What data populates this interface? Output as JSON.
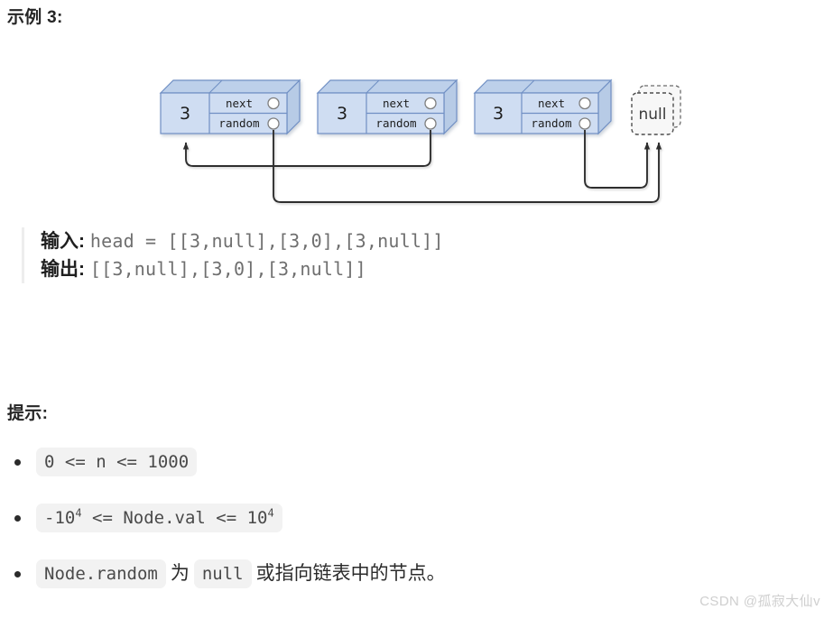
{
  "example": {
    "heading": "示例 3:",
    "input_label": "输入:",
    "input_value": "head = [[3,null],[3,0],[3,null]]",
    "output_label": "输出:",
    "output_value": "[[3,null],[3,0],[3,null]]"
  },
  "diagram": {
    "node_value": "3",
    "next_label": "next",
    "random_label": "random",
    "null_label": "null",
    "node_fill": "#cfddf2",
    "node_top_fill": "#bdd0ea",
    "node_side_fill": "#b7cbe6",
    "node_border": "#6f8fc4",
    "port_fill": "#ffffff",
    "port_border": "#7f7f7f",
    "arrow_color": "#2f2f2f",
    "null_border": "#6b6b6b",
    "null_fill": "#f7f7f7",
    "nodes": [
      {
        "value": "3",
        "next_label": "next",
        "random_label": "random",
        "next_target": "node-2",
        "random_target": "null-box"
      },
      {
        "value": "3",
        "next_label": "next",
        "random_label": "random",
        "next_target": "node-3",
        "random_target": "node-1"
      },
      {
        "value": "3",
        "next_label": "next",
        "random_label": "random",
        "next_target": "null-box",
        "random_target": "null-box"
      }
    ]
  },
  "hints": {
    "heading": "提示:",
    "items": [
      {
        "type": "code",
        "code": "0 <= n <= 1000"
      },
      {
        "type": "code_sup",
        "pre": "-10",
        "sup1": "4",
        "mid": " <= Node.val <= 10",
        "sup2": "4"
      },
      {
        "type": "mixed",
        "code1": "Node.random",
        "text1": "为",
        "code2": "null",
        "text2": "或指向链表中的节点。"
      }
    ]
  },
  "watermark": "CSDN @孤寂大仙v"
}
